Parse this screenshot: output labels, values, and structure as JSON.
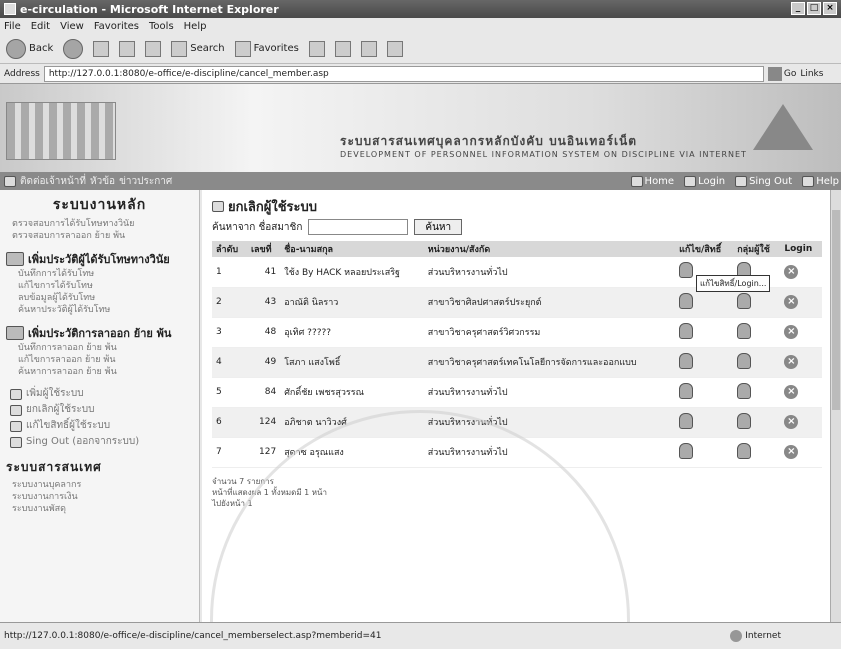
{
  "window": {
    "title": "e-circulation - Microsoft Internet Explorer"
  },
  "menu": [
    "File",
    "Edit",
    "View",
    "Favorites",
    "Tools",
    "Help"
  ],
  "toolbar": {
    "back": "Back",
    "search": "Search",
    "favorites": "Favorites"
  },
  "address": {
    "label": "Address",
    "url": "http://127.0.0.1:8080/e-office/e-discipline/cancel_member.asp",
    "go": "Go",
    "links": "Links"
  },
  "banner": {
    "title_th": "ระบบสารสนเทศบุคลากรหลักบังคับ บนอินเทอร์เน็ต",
    "title_en": "DEVELOPMENT OF PERSONNEL INFORMATION SYSTEM ON DISCIPLINE VIA INTERNET"
  },
  "navstrip": {
    "left": [
      "ติดต่อเจ้าหน้าที่",
      "หัวข้อ",
      "ข่าวประกาศ"
    ],
    "home": "Home",
    "login": "Login",
    "signout": "Sing Out",
    "help": "Help"
  },
  "sidebar": {
    "heading": "ระบบงานหลัก",
    "top_links": [
      "ตรวจสอบการได้รับโทษทางวินัย",
      "ตรวจสอบการลาออก ย้าย พ้น"
    ],
    "sections": [
      {
        "title": "เพิ่มประวัติผู้ได้รับโทษทางวินัย",
        "items": [
          "บันทึกการได้รับโทษ",
          "แก้ไขการได้รับโทษ",
          "ลบข้อมูลผู้ได้รับโทษ",
          "ค้นหาประวัติผู้ได้รับโทษ"
        ]
      },
      {
        "title": "เพิ่มประวัติการลาออก ย้าย พ้น",
        "items": [
          "บันทึกการลาออก ย้าย พ้น",
          "แก้ไขการลาออก ย้าย พ้น",
          "ค้นหาการลาออก ย้าย พ้น"
        ]
      }
    ],
    "user_items": [
      "เพิ่มผู้ใช้ระบบ",
      "ยกเลิกผู้ใช้ระบบ",
      "แก้ไขสิทธิ์ผู้ใช้ระบบ",
      "Sing Out (ออกจากระบบ)"
    ],
    "bottom_heading": "ระบบสารสนเทศ",
    "bottom_links": [
      "ระบบงานบุคลากร",
      "ระบบงานการเงิน",
      "ระบบงานพัสดุ"
    ]
  },
  "main": {
    "title": "ยกเลิกผู้ใช้ระบบ",
    "search_label": "ค้นหาจาก ชื่อสมาชิก",
    "search_value": "",
    "search_button": "ค้นหา",
    "columns": [
      "ลำดับ",
      "เลขที่",
      "ชื่อ-นามสกุล",
      "หน่วยงาน/สังกัด",
      "แก้ไข/สิทธิ์",
      "กลุ่มผู้ใช้",
      "Login"
    ],
    "rows": [
      {
        "no": "1",
        "id": "41",
        "name": "ใช้ง By HACK หลอยประเสริฐ",
        "dept": "ส่วนบริหารงานทั่วไป"
      },
      {
        "no": "2",
        "id": "43",
        "name": "อาณัติ นิลราว",
        "dept": "สาขาวิชาศิลปศาสตร์ประยุกต์"
      },
      {
        "no": "3",
        "id": "48",
        "name": "อุเทิศ ?????",
        "dept": "สาขาวิชาครุศาสตร์วิศวกรรม"
      },
      {
        "no": "4",
        "id": "49",
        "name": "โสภา แสงโพธิ์",
        "dept": "สาขาวิชาครุศาสตร์เทคโนโลยีการจัดการและออกแบบ"
      },
      {
        "no": "5",
        "id": "84",
        "name": "ศักดิ์ชัย เพชรสุวรรณ",
        "dept": "ส่วนบริหารงานทั่วไป"
      },
      {
        "no": "6",
        "id": "124",
        "name": "อภิชาต นาวิวงศ์",
        "dept": "ส่วนบริหารงานทั่วไป"
      },
      {
        "no": "7",
        "id": "127",
        "name": "สุดาซ อรุณแสง",
        "dept": "ส่วนบริหารงานทั่วไป"
      }
    ],
    "tooltip": "แก้ไขสิทธิ์/Login...",
    "footer": [
      "จำนวน 7 รายการ",
      "หน้าที่แสดงผล 1 ทั้งหมดมี 1 หน้า",
      "ไปยังหน้า 1"
    ]
  },
  "status": {
    "url": "http://127.0.0.1:8080/e-office/e-discipline/cancel_memberselect.asp?memberid=41",
    "zone": "Internet"
  }
}
